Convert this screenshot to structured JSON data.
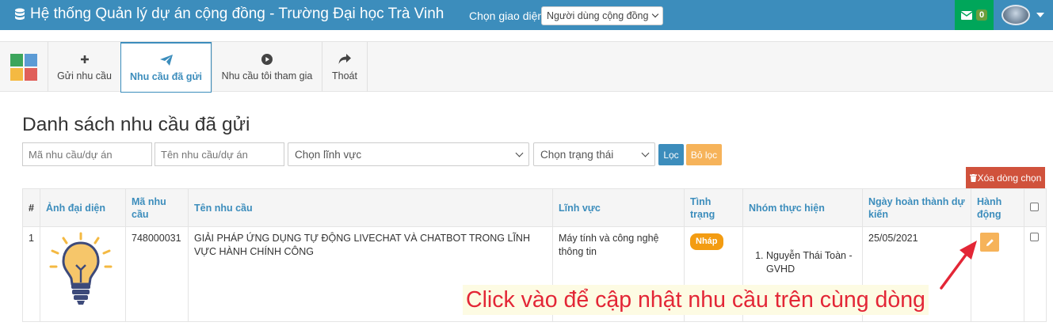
{
  "header": {
    "title": "Hệ thống Quản lý dự án cộng đồng - Trường Đại học Trà Vinh",
    "ui_label": "Chọn giao diện",
    "ui_select_value": "Người dùng cộng đồng",
    "mail_count": "0",
    "brand_color": "#3c8dbc"
  },
  "menu": {
    "items": [
      {
        "label": "Gửi nhu cầu",
        "icon": "plus-icon"
      },
      {
        "label": "Nhu cầu đã gửi",
        "icon": "paper-plane-icon"
      },
      {
        "label": "Nhu cầu tôi tham gia",
        "icon": "play-circle-icon"
      },
      {
        "label": "Thoát",
        "icon": "share-icon"
      }
    ]
  },
  "page": {
    "title": "Danh sách nhu cầu đã gửi"
  },
  "filters": {
    "code_placeholder": "Mã nhu cầu/dự án",
    "name_placeholder": "Tên nhu cầu/dự án",
    "field_select": "Chọn lĩnh vực",
    "status_select": "Chọn trạng thái",
    "filter_label": "Lọc",
    "reset_label": "Bỏ lọc",
    "delete_label": "Xóa dòng chọn"
  },
  "table": {
    "headers": [
      "#",
      "Ảnh đại diện",
      "Mã nhu cầu",
      "Tên nhu cầu",
      "Lĩnh vực",
      "Tình trạng",
      "Nhóm thực hiện",
      "Ngày hoàn thành dự kiến",
      "Hành động"
    ],
    "rows": [
      {
        "index": "1",
        "code": "748000031",
        "name": "GIẢI PHÁP ỨNG DỤNG TỰ ĐỘNG LIVECHAT VÀ CHATBOT TRONG LĨNH VỰC HÀNH CHÍNH CÔNG",
        "field": "Máy tính và công nghệ thông tin",
        "status": "Nháp",
        "team": [
          "Nguyễn Thái Toàn - GVHD"
        ],
        "due_date": "25/05/2021"
      }
    ]
  },
  "annotation": {
    "text": "Click vào để cập nhật nhu cầu trên cùng dòng",
    "color": "#e32636"
  }
}
